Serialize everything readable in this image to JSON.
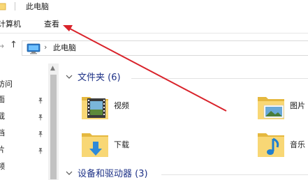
{
  "window": {
    "title": "此电脑"
  },
  "ribbon": {
    "tabs": [
      "计算机",
      "查看"
    ],
    "visible_tabs": [
      "计算机",
      "查看"
    ]
  },
  "ribbon_display": {
    "computer_tab": "计算机",
    "view_tab": "查看"
  },
  "address": {
    "path": "此电脑",
    "chevron": "›",
    "up_arrow": "↑",
    "forward_arrow": "→"
  },
  "navigation": {
    "items": [
      "访问",
      "面",
      "载",
      "档",
      "片",
      "频"
    ],
    "pinned": [
      false,
      true,
      true,
      true,
      true,
      false
    ]
  },
  "main": {
    "folders_group": {
      "label": "文件夹 (6)"
    },
    "folders": [
      {
        "name": "视频",
        "icon": "video-folder-icon"
      },
      {
        "name": "图片",
        "icon": "pictures-folder-icon"
      },
      {
        "name": "下载",
        "icon": "downloads-folder-icon"
      },
      {
        "name": "音乐",
        "icon": "music-folder-icon"
      }
    ],
    "devices_group": {
      "label": "设备和驱动器 (3)"
    }
  },
  "colors": {
    "accent": "#1e3287",
    "annotation": "#d9232b",
    "folder_body": "#f8d775",
    "folder_tab": "#e5b83f"
  }
}
